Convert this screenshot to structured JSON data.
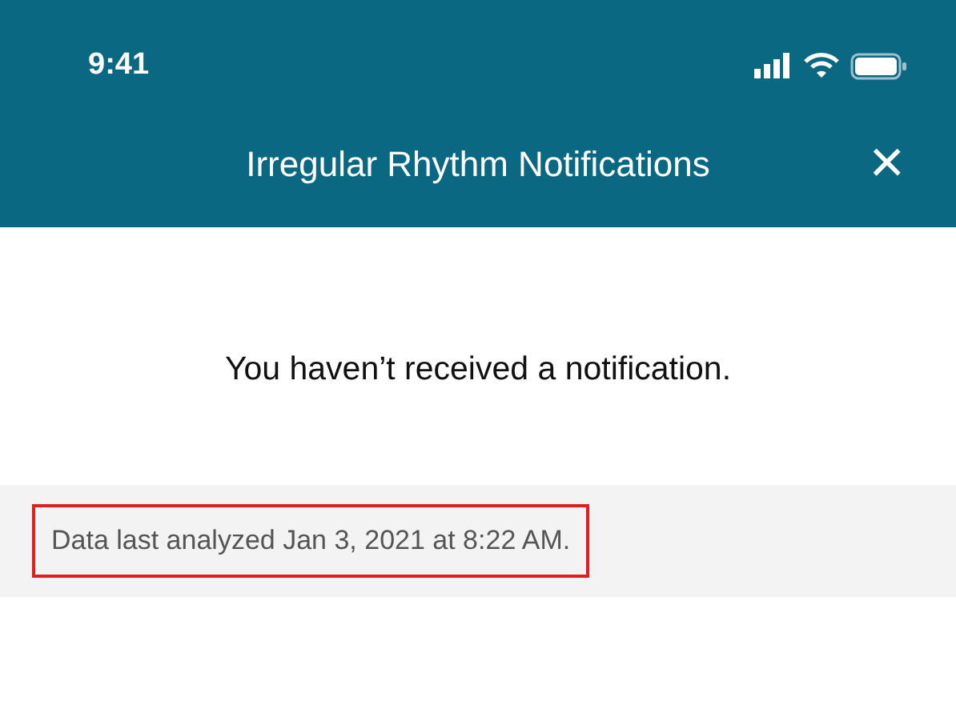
{
  "status_bar": {
    "time": "9:41"
  },
  "header": {
    "title": "Irregular Rhythm Notifications",
    "close": "×"
  },
  "message": "You haven’t received a notification.",
  "footer_note": {
    "text": "Data last analyzed Jan 3, 2021 at 8:22 AM.",
    "highlighted": true
  }
}
